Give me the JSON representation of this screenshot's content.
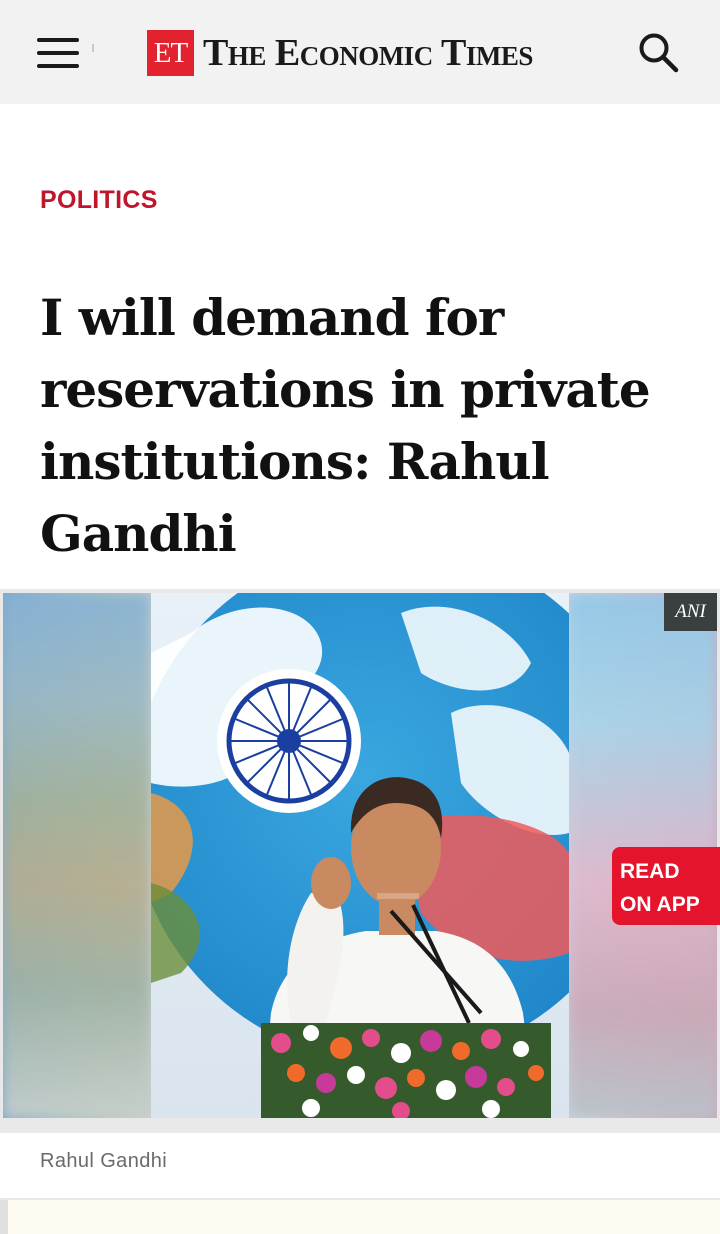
{
  "header": {
    "menu_icon": "hamburger-menu-icon",
    "logo_badge": "ET",
    "logo_text": "The Economic Times",
    "search_icon": "search-icon",
    "brand_color": "#e2222e"
  },
  "article": {
    "category": "POLITICS",
    "category_color": "#c0162b",
    "headline": "I will demand for reservations in private institutions: Rahul Gandhi",
    "image": {
      "credit": "ANI",
      "caption": "Rahul Gandhi"
    },
    "read_on_app": {
      "line1": "READ",
      "line2": "ON APP",
      "color": "#e5142d"
    }
  }
}
